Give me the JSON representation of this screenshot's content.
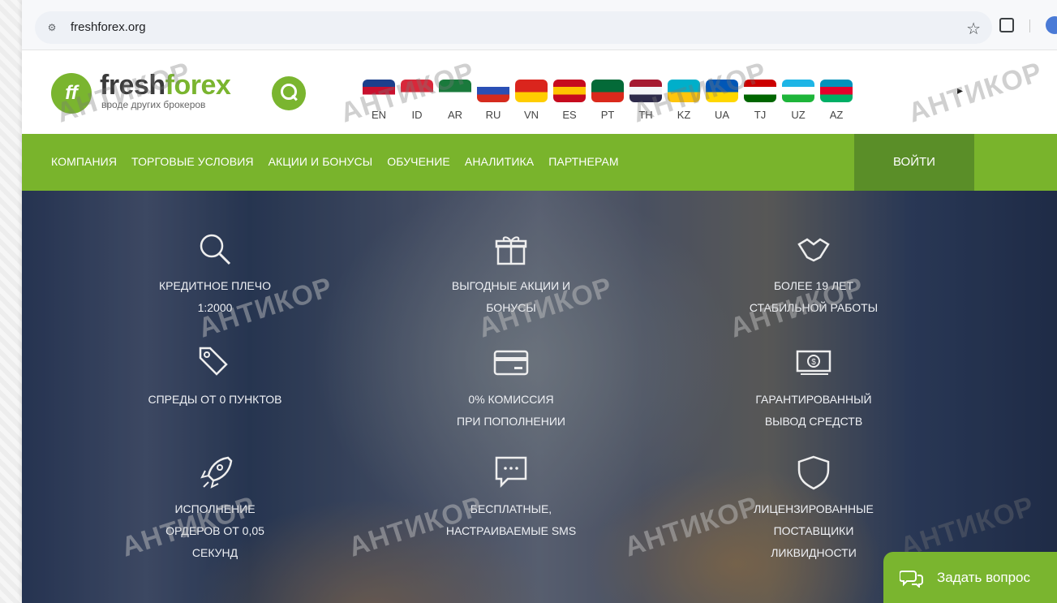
{
  "browser": {
    "url": "freshforex.org",
    "tune_icon": "tune-icon",
    "star_icon": "star-icon",
    "extensions_icon": "puzzle-icon"
  },
  "site": {
    "logo": {
      "fresh": "fresh",
      "forex": "forex",
      "tagline": "вроде других брокеров",
      "mark": "ff"
    },
    "languages": [
      {
        "code": "EN",
        "flag": [
          "#1c3f8c",
          "#c8102e",
          "#ffffff"
        ]
      },
      {
        "code": "ID",
        "flag": [
          "#d8283a",
          "#ffffff"
        ]
      },
      {
        "code": "AR",
        "flag": [
          "#1a7a3c",
          "#ffffff"
        ]
      },
      {
        "code": "RU",
        "flag": [
          "#ffffff",
          "#2a4fb5",
          "#d52b1e"
        ]
      },
      {
        "code": "VN",
        "flag": [
          "#da251d",
          "#ffcd00"
        ]
      },
      {
        "code": "ES",
        "flag": [
          "#c60b1e",
          "#ffc400",
          "#c60b1e"
        ]
      },
      {
        "code": "PT",
        "flag": [
          "#046a38",
          "#da291c"
        ]
      },
      {
        "code": "TH",
        "flag": [
          "#a51931",
          "#f4f5f8",
          "#2d2a4a"
        ]
      },
      {
        "code": "KZ",
        "flag": [
          "#00afca",
          "#fec50c"
        ]
      },
      {
        "code": "UA",
        "flag": [
          "#0057b7",
          "#ffd700"
        ]
      },
      {
        "code": "TJ",
        "flag": [
          "#cc0000",
          "#ffffff",
          "#006600"
        ]
      },
      {
        "code": "UZ",
        "flag": [
          "#1eb5e6",
          "#ffffff",
          "#1eb53a"
        ]
      },
      {
        "code": "AZ",
        "flag": [
          "#0092bc",
          "#e4002b",
          "#00af66"
        ]
      }
    ],
    "nav": [
      "КОМПАНИЯ",
      "ТОРГОВЫЕ УСЛОВИЯ",
      "АКЦИИ И БОНУСЫ",
      "ОБУЧЕНИЕ",
      "АНАЛИТИКА",
      "ПАРТНЕРАМ"
    ],
    "login": "ВОЙТИ",
    "features": [
      {
        "icon": "magnifier-icon",
        "text": "КРЕДИТНОЕ ПЛЕЧО\n1:2000"
      },
      {
        "icon": "gift-icon",
        "text": "ВЫГОДНЫЕ АКЦИИ И\nБОНУСЫ"
      },
      {
        "icon": "handshake-icon",
        "text": "БОЛЕЕ 19 ЛЕТ\nСТАБИЛЬНОЙ РАБОТЫ"
      },
      {
        "icon": "price-tag-icon",
        "text": "СПРЕДЫ ОТ 0 ПУНКТОВ"
      },
      {
        "icon": "credit-card-icon",
        "text": "0% КОМИССИЯ\nПРИ ПОПОЛНЕНИИ"
      },
      {
        "icon": "money-icon",
        "text": "ГАРАНТИРОВАННЫЙ\nВЫВОД СРЕДСТВ"
      },
      {
        "icon": "rocket-icon",
        "text": "ИСПОЛНЕНИЕ\nОРДЕРОВ ОТ 0,05\nСЕКУНД"
      },
      {
        "icon": "sms-icon",
        "text": "БЕСПЛАТНЫЕ,\nНАСТРАИВАЕМЫЕ SMS"
      },
      {
        "icon": "shield-icon",
        "text": "ЛИЦЕНЗИРОВАННЫЕ\nПОСТАВЩИКИ\nЛИКВИДНОСТИ"
      }
    ],
    "chat": "Задать вопрос"
  },
  "watermark": "АНТИКОР",
  "colors": {
    "brand_green": "#7ab52f",
    "login_green": "#5a8e28"
  }
}
